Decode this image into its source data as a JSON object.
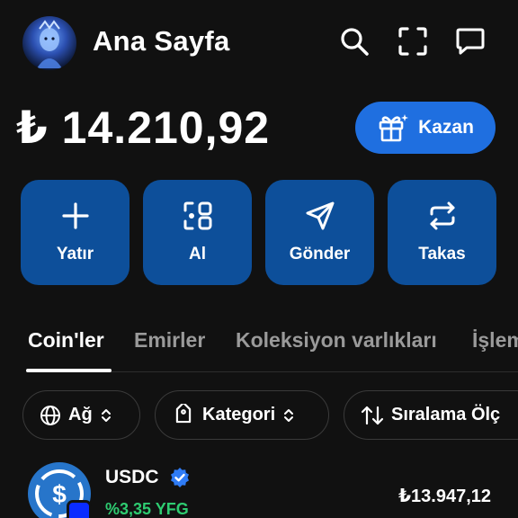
{
  "header": {
    "title": "Ana Sayfa",
    "icons": [
      "search-icon",
      "scan-icon",
      "chat-icon"
    ]
  },
  "balance": {
    "amount": "₺ 14.210,92"
  },
  "earn_button": {
    "label": "Kazan",
    "icon": "gift-icon",
    "color": "#1f6fe0"
  },
  "actions": [
    {
      "label": "Yatır",
      "icon": "plus-icon"
    },
    {
      "label": "Al",
      "icon": "buy-icon"
    },
    {
      "label": "Gönder",
      "icon": "send-icon"
    },
    {
      "label": "Takas",
      "icon": "swap-icon"
    }
  ],
  "action_color": "#0d4f9a",
  "tabs": [
    {
      "label": "Coin'ler",
      "active": true
    },
    {
      "label": "Emirler",
      "active": false
    },
    {
      "label": "Koleksiyon varlıkları",
      "active": false
    },
    {
      "label": "İşlem",
      "active": false
    }
  ],
  "filters": [
    {
      "label": "Ağ",
      "icon": "globe-icon"
    },
    {
      "label": "Kategori",
      "icon": "tag-icon"
    },
    {
      "label": "Sıralama Ölç",
      "icon": "sort-icon"
    }
  ],
  "coins": [
    {
      "name": "USDC",
      "verified": true,
      "change": "%3,35 YFG",
      "value": "₺13.947,12",
      "change_color": "#2ecc71"
    }
  ]
}
